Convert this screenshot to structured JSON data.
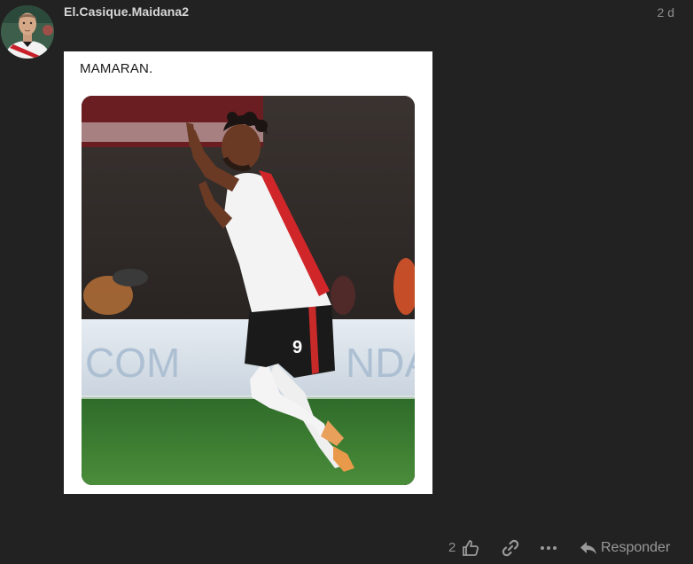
{
  "post": {
    "username": "El.Casique.Maidana2",
    "date": "2 d",
    "text": "MAMARAN.",
    "image": {
      "stadium_banner_text": "COM",
      "stadium_banner_text_right": "NDA",
      "jersey_number": "9"
    }
  },
  "actions": {
    "like_count": "2",
    "like_icon": "thumbs-up-icon",
    "link_icon": "link-icon",
    "more_icon": "ellipsis-icon",
    "reply_icon": "reply-arrow-icon",
    "reply_label": "Responder"
  },
  "colors": {
    "background": "#222222",
    "username": "#d8d8d8",
    "muted": "#8f8f8f",
    "card": "#ffffff"
  }
}
